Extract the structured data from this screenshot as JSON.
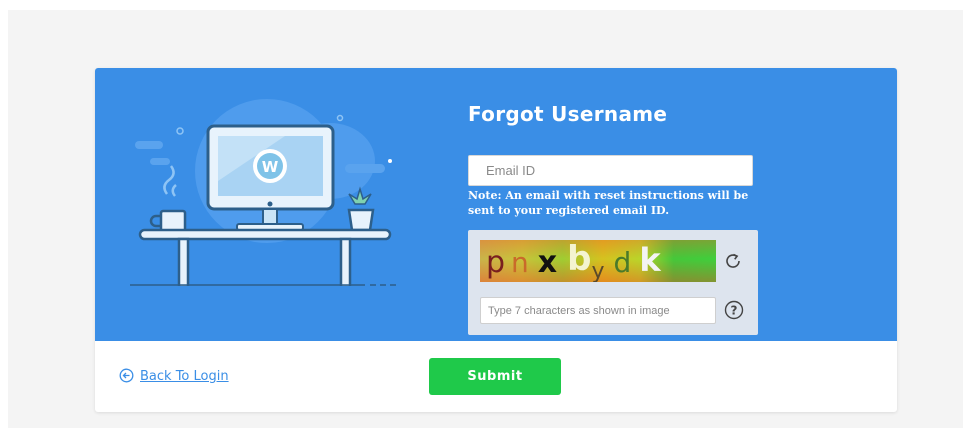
{
  "form": {
    "title": "Forgot Username",
    "email_placeholder": "Email ID",
    "note": "Note: An email with reset instructions will be sent to your registered email ID."
  },
  "captcha": {
    "chars": [
      {
        "char": "p",
        "color": "#7a1f1f"
      },
      {
        "char": "n",
        "color": "#c96a2a"
      },
      {
        "char": "x",
        "color": "#111111"
      },
      {
        "char": "b",
        "color": "#f4f4d0"
      },
      {
        "char": "y",
        "color": "#5a4a2a"
      },
      {
        "char": "d",
        "color": "#4a7a2a"
      },
      {
        "char": "k",
        "color": "#f4f4f4"
      }
    ],
    "input_placeholder": "Type 7 characters as shown in image"
  },
  "footer": {
    "back_label": "Back To Login",
    "submit_label": "Submit"
  },
  "icons": {
    "back": "circle-arrow-left-icon",
    "refresh": "refresh-icon",
    "help": "question-circle-icon",
    "logo": "w-logo-icon"
  },
  "colors": {
    "hero_bg": "#3a8ee6",
    "submit_bg": "#1fc94a",
    "link": "#3a8ee6"
  }
}
